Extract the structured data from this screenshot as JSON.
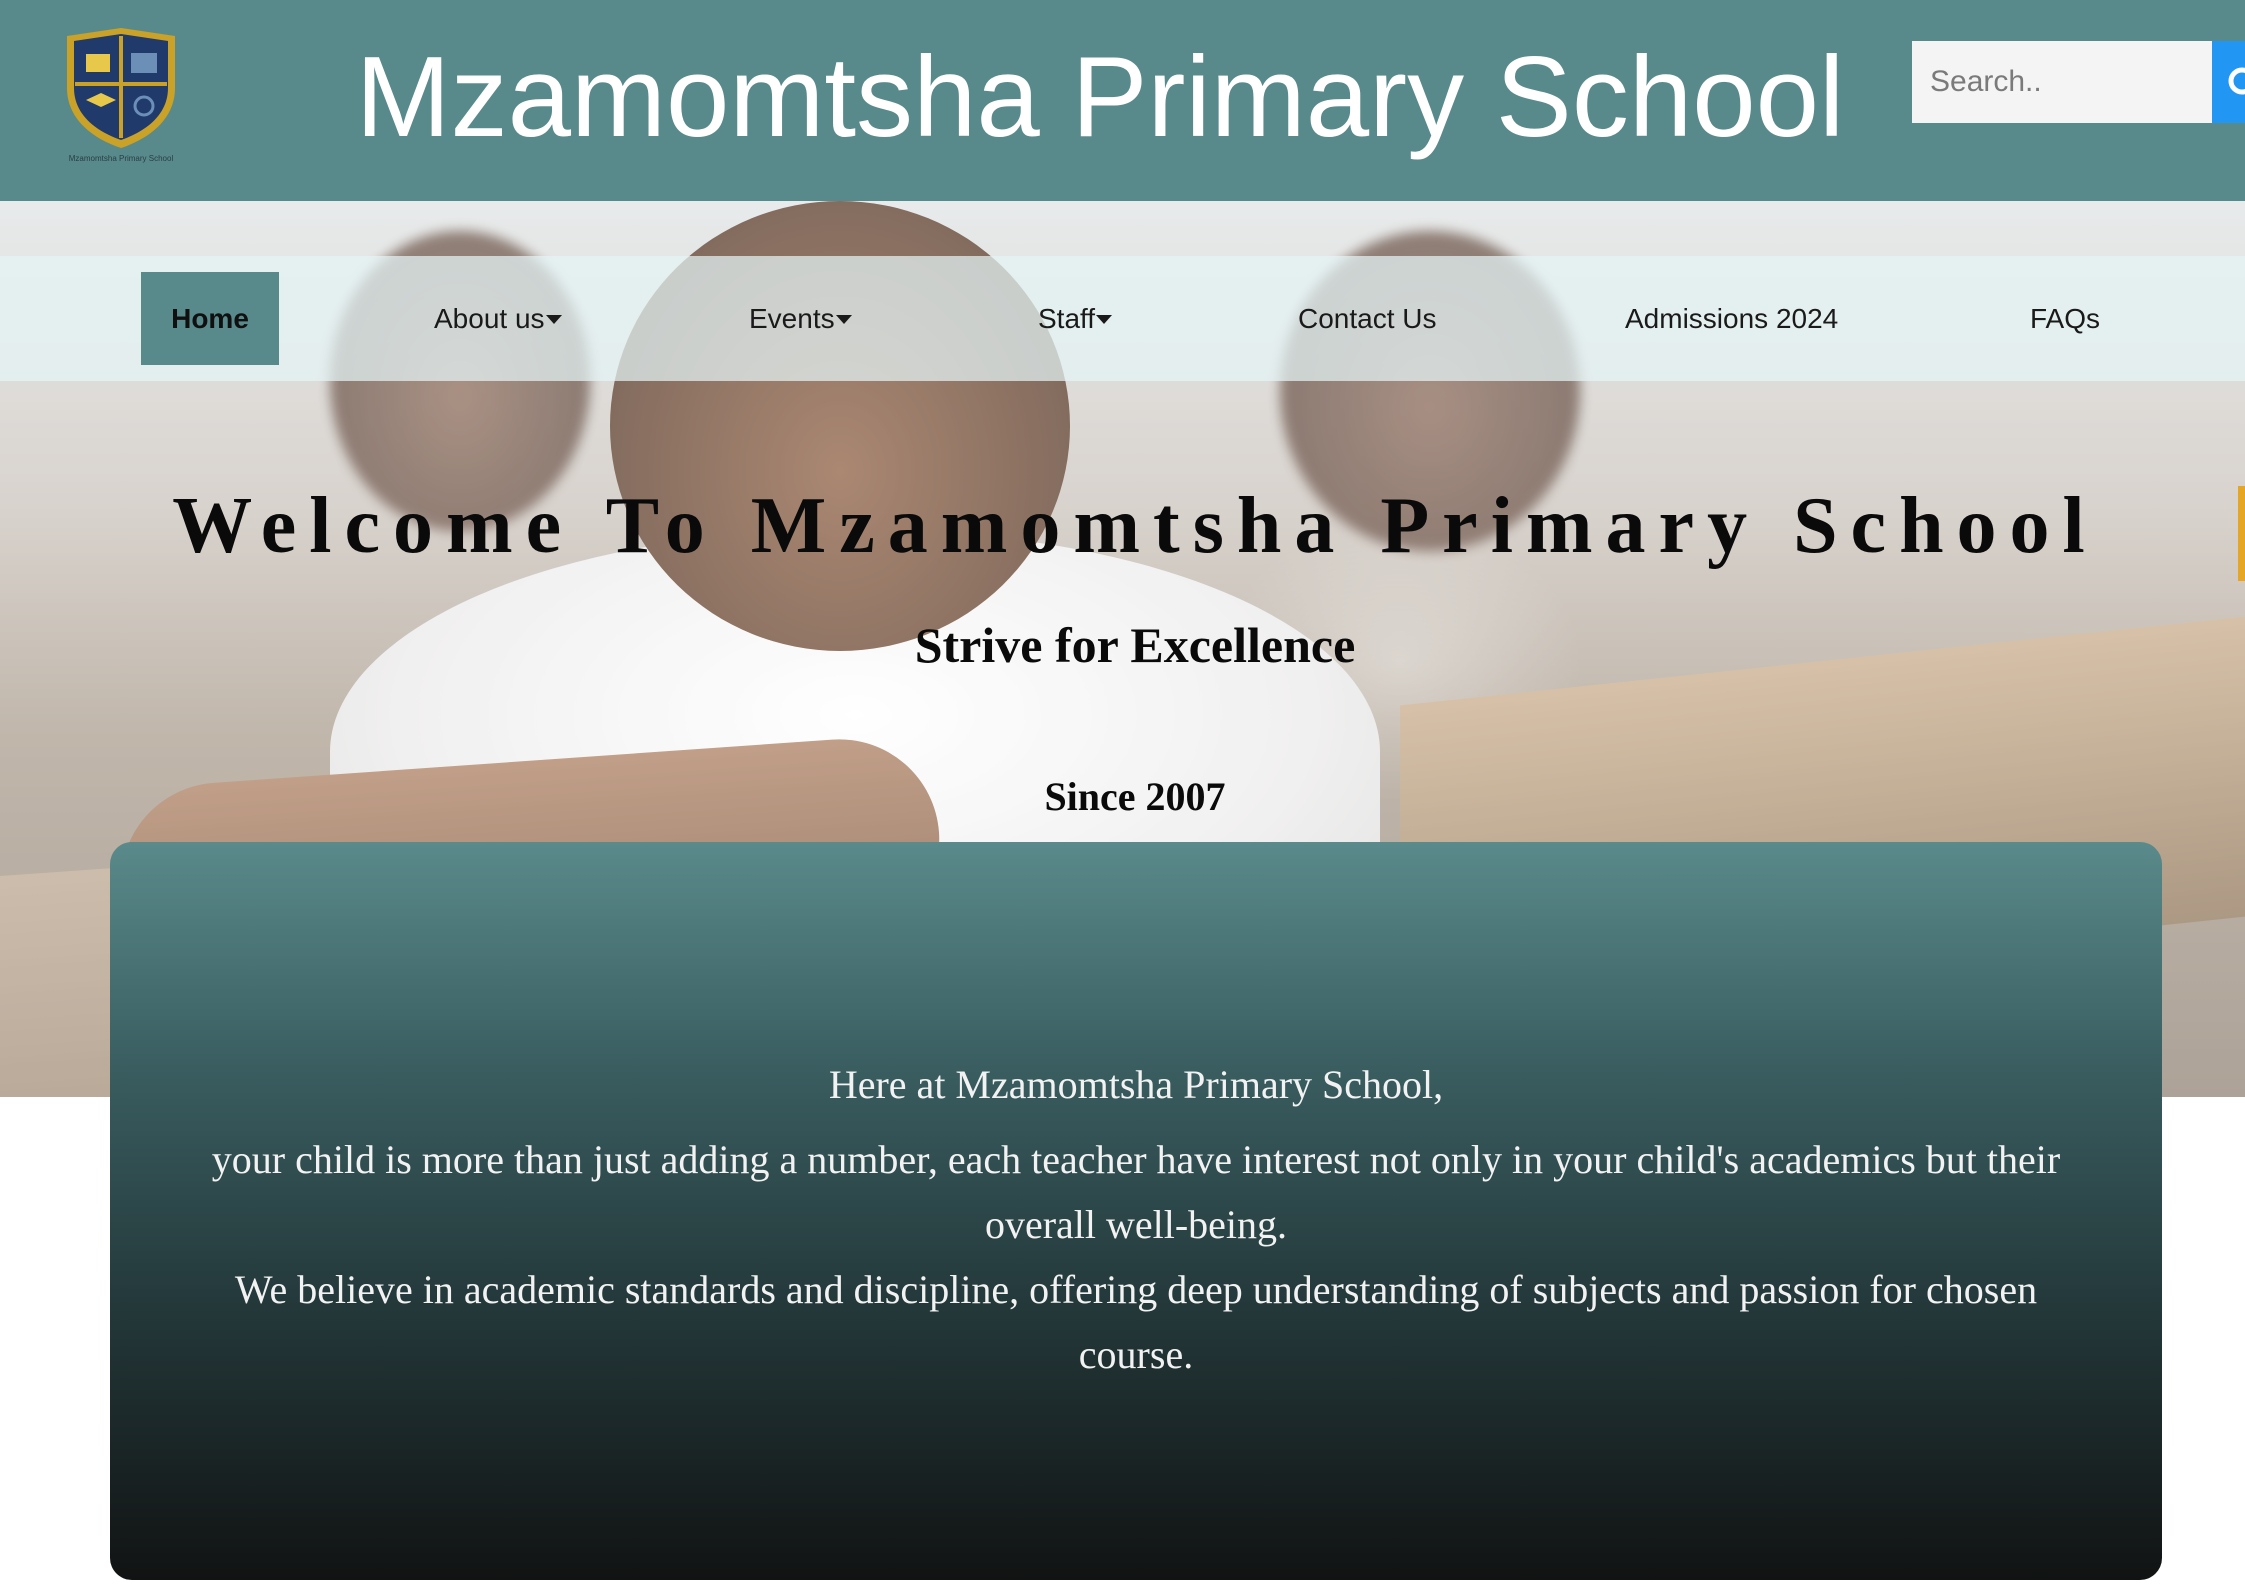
{
  "header": {
    "logo_icon": "school-crest-icon",
    "logo_caption": "Mzamomtsha Primary School",
    "title": "Mzamomtsha Primary School",
    "search": {
      "placeholder": "Search..",
      "button_icon": "search-icon"
    }
  },
  "nav": {
    "items": [
      {
        "label": "Home",
        "active": true
      },
      {
        "label": "About us",
        "has_dropdown": true
      },
      {
        "label": "Events",
        "has_dropdown": true
      },
      {
        "label": "Staff",
        "has_dropdown": true
      },
      {
        "label": "Contact Us"
      },
      {
        "label": "Admissions 2024"
      },
      {
        "label": "FAQs"
      }
    ]
  },
  "hero": {
    "heading": "Welcome To Mzamomtsha Primary School",
    "tagline": "Strive for Excellence",
    "since": "Since 2007"
  },
  "intro": {
    "line1": "Here at Mzamomtsha Primary School,",
    "paragraph1": "your child is more than just adding a number, each teacher have interest not only in your child's academics but their overall well-being.",
    "paragraph2": "We believe in academic standards and discipline, offering deep understanding of subjects and passion for chosen course."
  },
  "colors": {
    "header_bg": "#588a8b",
    "nav_active_bg": "#588a8b",
    "search_button": "#2196f3",
    "card_top": "#5a8a8b",
    "card_bottom": "#111313"
  }
}
